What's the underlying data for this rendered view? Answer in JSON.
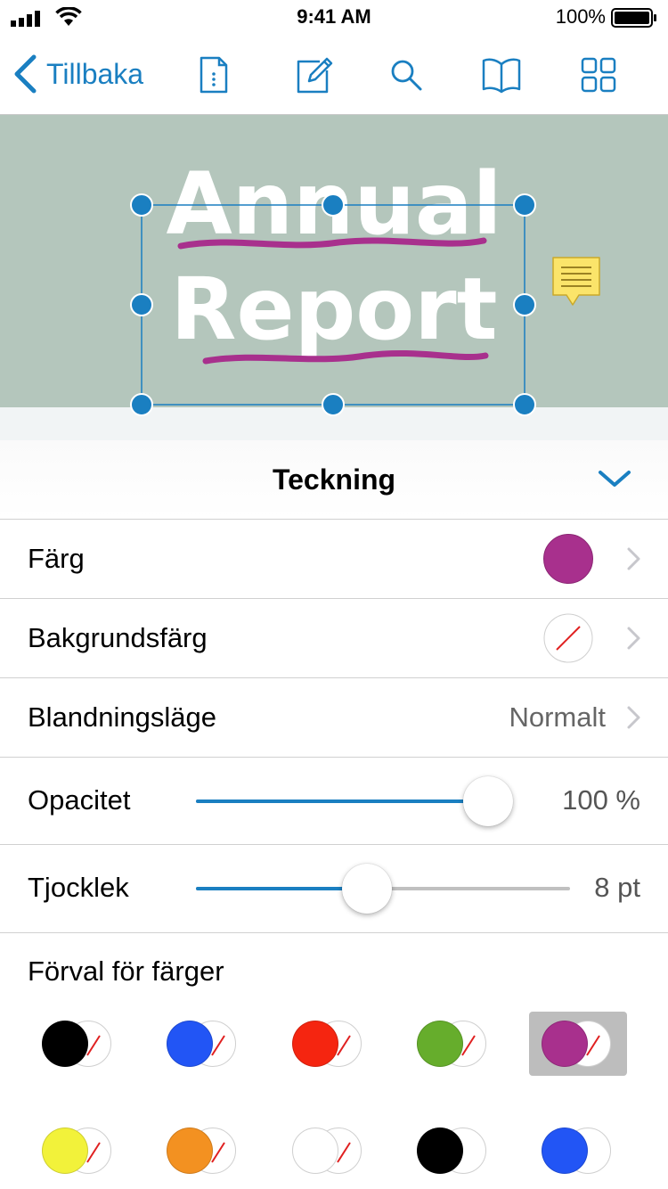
{
  "status": {
    "time": "9:41 AM",
    "battery": "100%"
  },
  "nav": {
    "back_label": "Tillbaka"
  },
  "document": {
    "title_line1": "Annual",
    "title_line2": "Report"
  },
  "panel": {
    "title": "Teckning",
    "color_label": "Färg",
    "color_value": "#a8308d",
    "background_label": "Bakgrundsfärg",
    "blend_label": "Blandningsläge",
    "blend_value": "Normalt",
    "opacity_label": "Opacitet",
    "opacity_value": "100 %",
    "opacity_fraction": 1.0,
    "thickness_label": "Tjocklek",
    "thickness_value": "8 pt",
    "thickness_fraction": 0.45,
    "presets_label": "Förval för färger"
  },
  "presets": [
    {
      "color": "#000000",
      "background": "none",
      "selected": false
    },
    {
      "color": "#2255f5",
      "background": "none",
      "selected": false
    },
    {
      "color": "#f52510",
      "background": "none",
      "selected": false
    },
    {
      "color": "#66ad2c",
      "background": "none",
      "selected": false
    },
    {
      "color": "#a8308d",
      "background": "none",
      "selected": true
    },
    {
      "color": "#f2f23a",
      "background": "none",
      "selected": false
    },
    {
      "color": "#f39121",
      "background": "none",
      "selected": false
    },
    {
      "color": "#ffffff",
      "background": "none",
      "selected": false
    },
    {
      "color": "#000000",
      "background": "#ffffff",
      "selected": false
    },
    {
      "color": "#2255f5",
      "background": "#ffffff",
      "selected": false
    }
  ],
  "colors": {
    "accent": "#1a7fc1",
    "ink": "#a8308d",
    "banner": "#b4c6bc"
  }
}
